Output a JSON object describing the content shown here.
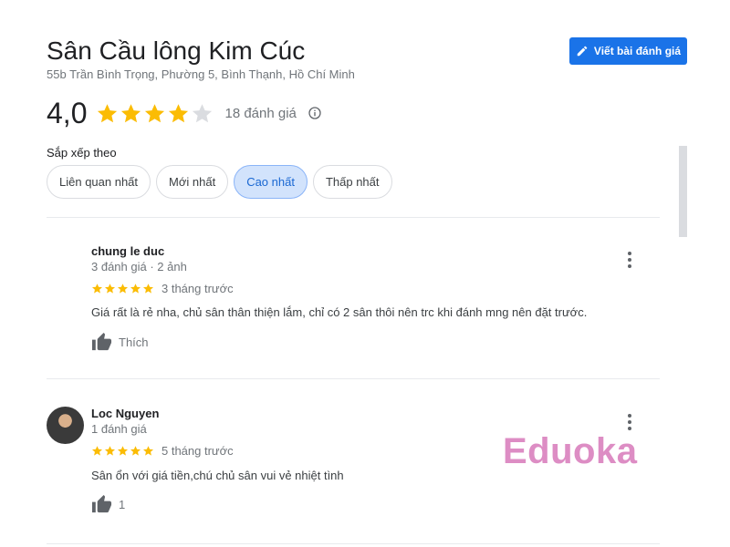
{
  "place": {
    "title": "Sân Cầu lông Kim Cúc",
    "address": "55b Trần Bình Trọng, Phường 5, Bình Thạnh, Hồ Chí Minh"
  },
  "write_review_button": {
    "label": "Viết bài đánh giá",
    "icon": "pencil-icon"
  },
  "summary": {
    "rating": "4,0",
    "stars": 4,
    "count_label": "18 đánh giá",
    "info_icon": "info-icon"
  },
  "sort": {
    "label": "Sắp xếp theo",
    "options": [
      "Liên quan nhất",
      "Mới nhất",
      "Cao nhất",
      "Thấp nhất"
    ],
    "selected": "Cao nhất"
  },
  "reviews": [
    {
      "name": "chung le duc",
      "meta": "3 đánh giá · 2 ảnh",
      "stars": 5,
      "time": "3 tháng trước",
      "text": "Giá rất là rẻ nha, chủ sân thân thiện lắm, chỉ có 2 sân thôi nên trc khi đánh mng nên đặt trước.",
      "like_label": "Thích",
      "has_avatar": false
    },
    {
      "name": "Loc Nguyen",
      "meta": "1 đánh giá",
      "stars": 5,
      "time": "5 tháng trước",
      "text": "Sân ổn với giá tiền,chú chủ sân vui vẻ nhiệt tình",
      "like_label": "1",
      "has_avatar": true
    }
  ],
  "watermark": "Eduoka",
  "colors": {
    "accent": "#1a73e8",
    "star": "#fbbc04",
    "star_empty": "#dadce0",
    "chip_selected": "#d2e3fc",
    "watermark": "#dd8dc4"
  }
}
